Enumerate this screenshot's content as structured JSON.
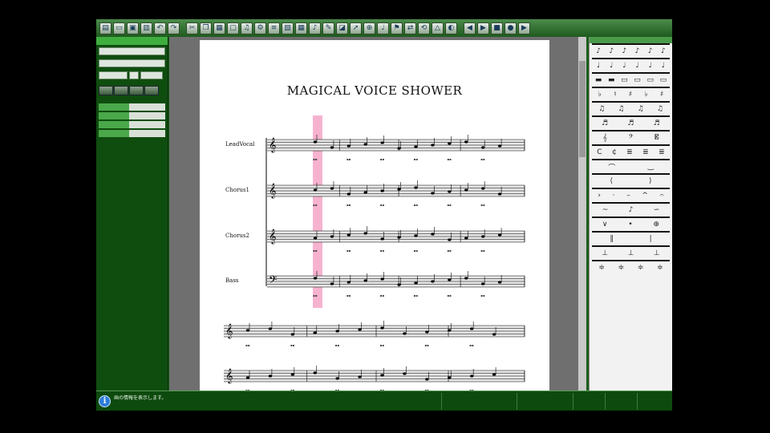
{
  "score": {
    "title": "MAGICAL VOICE SHOWER",
    "staves": [
      {
        "name": "LeadVocal"
      },
      {
        "name": "Chorus1"
      },
      {
        "name": "Chorus2"
      },
      {
        "name": "Bass"
      }
    ]
  },
  "status": {
    "message": "画の情報を表示します。"
  },
  "colors": {
    "app_green": "#1b5e1b",
    "panel_green": "#0f4d0f",
    "playhead": "#f5a6c8",
    "staff_highlight": "#e6e6e6"
  },
  "icons": {
    "status": "info-icon"
  }
}
